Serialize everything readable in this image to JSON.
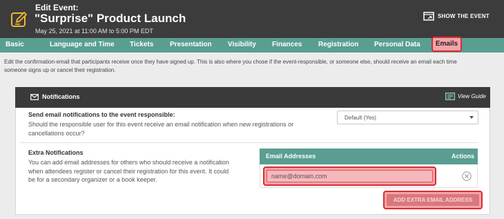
{
  "header": {
    "label": "Edit Event:",
    "title": "\"Surprise\" Product Launch",
    "date": "May 25, 2021 at 11:00 AM to 5:00 PM EDT",
    "show_event_label": "SHOW THE EVENT"
  },
  "tabs": [
    {
      "label": "Basic"
    },
    {
      "label": "Language and Time"
    },
    {
      "label": "Tickets"
    },
    {
      "label": "Presentation"
    },
    {
      "label": "Visibility"
    },
    {
      "label": "Finances"
    },
    {
      "label": "Registration"
    },
    {
      "label": "Personal Data"
    },
    {
      "label": "Emails",
      "active": true
    }
  ],
  "intro": {
    "line1": "Edit the confirmation-email that participants receive once they have signed up. This is also where you chose if the event-responsible, or someone else, should receive an email each time",
    "line2": "someone signs up or cancel their registration."
  },
  "notifications": {
    "title": "Notifications",
    "view_guide": "View Guide",
    "responsible": {
      "label": "Send email notifications to the event responsible:",
      "line1": "Should the responsible user for this event receive an email notification when new registrations or",
      "line2": "cancellations occur?",
      "select_value": "Default (Yes)"
    },
    "extra": {
      "label": "Extra Notifications",
      "line1": "You can add email addresses for others who should receive a notification",
      "line2": "when attendees register or cancel their registration for this event. It could",
      "line3": "be for a secondary organizer or a book keeper.",
      "table_headers": {
        "email": "Email Addresses",
        "actions": "Actions"
      },
      "email_placeholder": "name@domain.com",
      "add_button": "ADD EXTRA EMAIL ADDRESS"
    }
  },
  "colors": {
    "topbar": "#3c3c3c",
    "tabbar": "#5a9e92",
    "highlight_fill": "#f4a3a8",
    "highlight_border": "#d92c35"
  }
}
